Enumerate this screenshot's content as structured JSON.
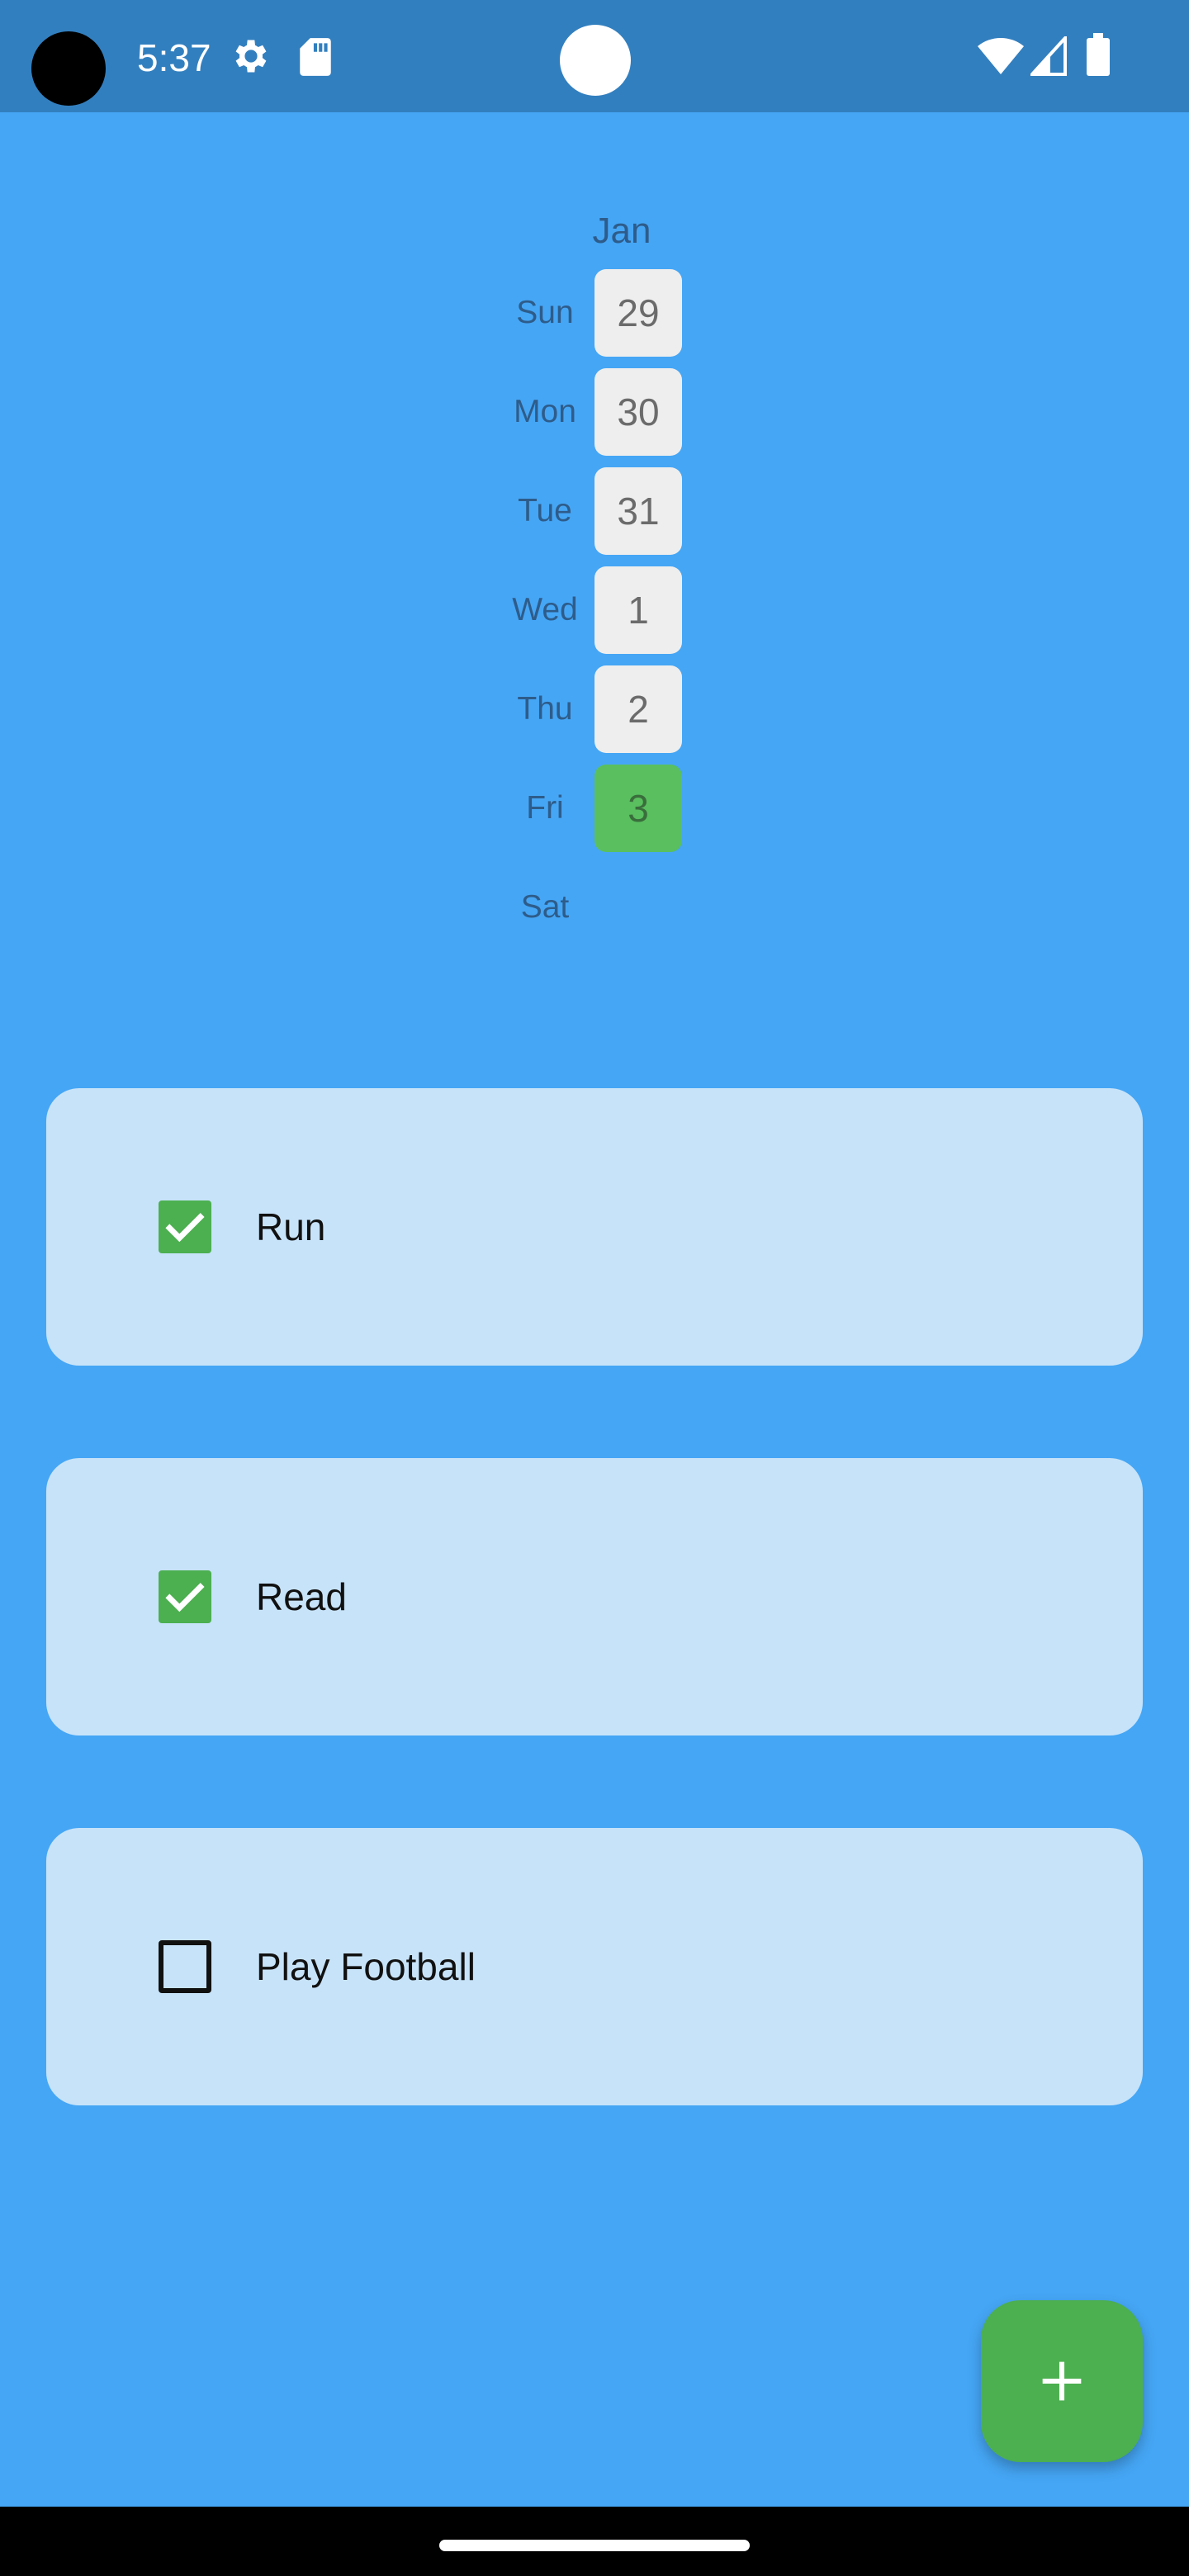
{
  "status_bar": {
    "time": "5:37",
    "icons": [
      "settings-gear-icon",
      "sd-card-icon",
      "wifi-icon",
      "cellular-signal-icon",
      "battery-icon"
    ],
    "background_color": "#327fbf"
  },
  "calendar": {
    "month": "Jan",
    "days": [
      {
        "name": "Sun",
        "date": "29"
      },
      {
        "name": "Mon",
        "date": "30"
      },
      {
        "name": "Tue",
        "date": "31"
      },
      {
        "name": "Wed",
        "date": "1"
      },
      {
        "name": "Thu",
        "date": "2"
      },
      {
        "name": "Fri",
        "date": "3",
        "today": true
      },
      {
        "name": "Sat",
        "date": ""
      }
    ],
    "today_color": "#59bf5f"
  },
  "habits": [
    {
      "label": "Run",
      "checked": true
    },
    {
      "label": "Read",
      "checked": true
    },
    {
      "label": "Play Football",
      "checked": false
    }
  ],
  "fab": {
    "icon": "plus-icon",
    "color": "#4caf50"
  },
  "colors": {
    "background": "#45a6f5",
    "card": "#c7e3f9",
    "check": "#4caf50"
  }
}
